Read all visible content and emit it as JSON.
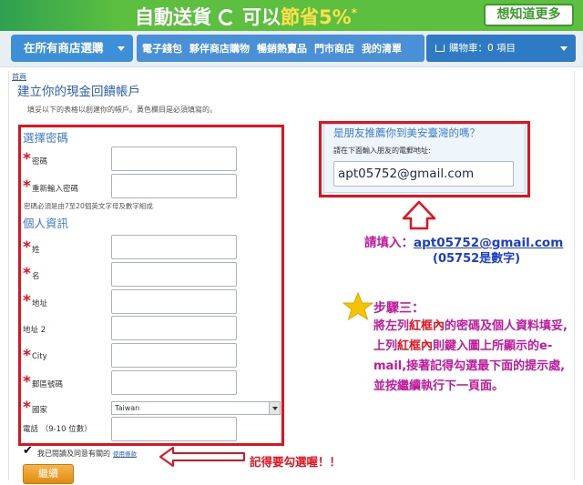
{
  "banner": {
    "part1": "自動送貨",
    "part2": "可以",
    "part3": "節省",
    "part4": "5%",
    "asterisk": "*",
    "more_button": "想知道更多"
  },
  "nav": {
    "store_select": "在所有商店選購",
    "links": [
      "電子錢包",
      "夥伴商店購物",
      "暢銷熱賣品",
      "門市商店",
      "我的清單"
    ],
    "cart": "購物車：0 項目"
  },
  "page": {
    "breadcrumb": "首頁",
    "title": "建立你的現金回饋帳戶",
    "intro": "填妥以下的表格以創建你的帳戶。黃色欄目是必須填寫的。"
  },
  "form": {
    "password_section": "選擇密碼",
    "password_label": "密碼",
    "password_confirm_label": "重新輸入密碼",
    "password_hint": "密碼必須是由7至20個英文字母及數字組成",
    "personal_section": "個人資訊",
    "last_name_label": "姓",
    "first_name_label": "名",
    "address_label": "地址",
    "address2_label": "地址 2",
    "city_label": "City",
    "postcode_label": "郵區號碼",
    "country_label": "國家",
    "country_value": "Taiwan",
    "phone_label": "電話 （9-10 位數）",
    "terms_text": "我已閱讀及同意有關的",
    "terms_link": "使用條款",
    "continue_button": "繼續"
  },
  "referral": {
    "title": "是朋友推薦你到美安臺灣的嗎？",
    "subtitle": "請在下面輸入朋友的電郵地址:",
    "email": "apt05752@gmail.com"
  },
  "annotations": {
    "fill_prefix": "請填入：",
    "fill_email": "apt05752@gmail.com",
    "fill_note": "(05752是數字)",
    "step_title": "步驟三：",
    "step_line1a": "將左列",
    "step_red1": "紅框內",
    "step_line1b": "的密碼及個人資料填妥,上列",
    "step_red2": "紅框內",
    "step_line2": "則鍵入圖上所顯示的e-mail,接著記得勾選最下面的提示處,並按繼續執行下一頁面。",
    "remember": "記得要勾選喔！！"
  },
  "colors": {
    "annotation_red": "#e8101c",
    "annotation_magenta": "#c2199e",
    "annotation_blue": "#1a3fd0",
    "link_blue": "#2a5fb0",
    "banner_green": "#5cbf3f"
  }
}
